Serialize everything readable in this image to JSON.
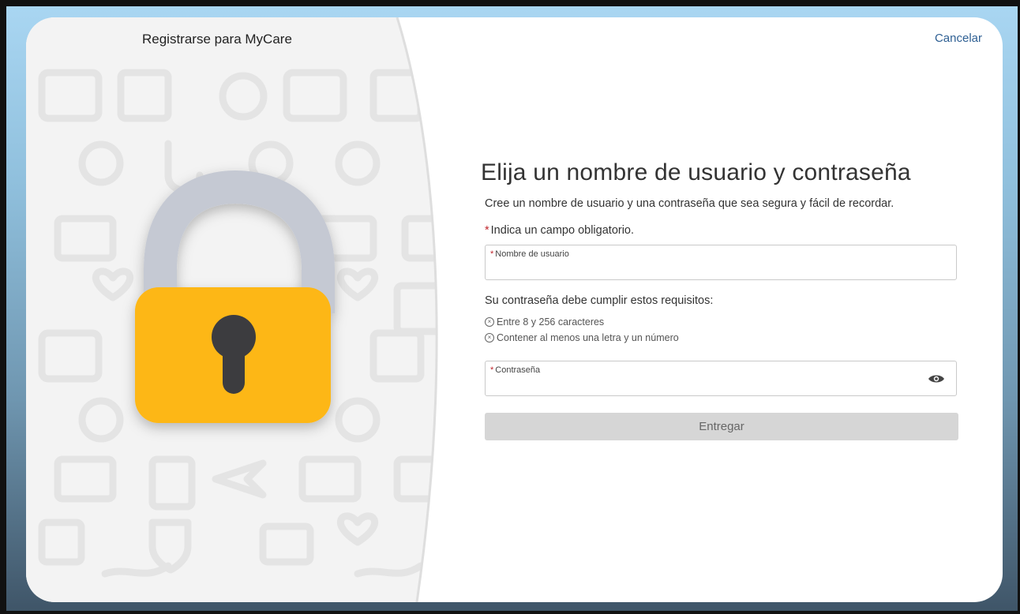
{
  "header": {
    "title": "Registrarse para MyCare",
    "cancel_label": "Cancelar"
  },
  "form": {
    "heading": "Elija un nombre de usuario y contraseña",
    "subtext": "Cree un nombre de usuario y una contraseña que sea segura y fácil de recordar.",
    "required_star": "*",
    "required_note": "Indica un campo obligatorio.",
    "username": {
      "label": "Nombre de usuario",
      "value": ""
    },
    "password_requirements_title": "Su contraseña debe cumplir estos requisitos:",
    "requirements": [
      {
        "icon": "x-circle-icon",
        "text": "Entre 8 y 256 caracteres"
      },
      {
        "icon": "x-circle-icon",
        "text": "Contener al menos una letra y un número"
      }
    ],
    "password": {
      "label": "Contraseña",
      "value": "",
      "toggle_icon": "eye-icon"
    },
    "submit_label": "Entregar"
  },
  "colors": {
    "lock_body": "#fdb714",
    "lock_shackle": "#c5c9d3",
    "keyhole": "#3c3c3f",
    "required_star": "#c0262d",
    "link": "#2e5f93",
    "button_disabled": "#d6d6d6"
  }
}
